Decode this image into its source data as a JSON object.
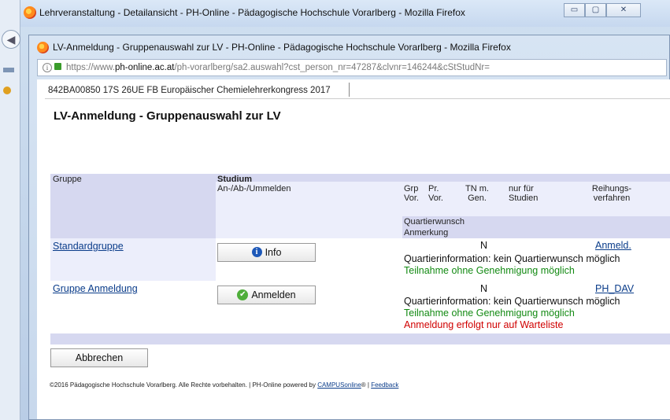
{
  "outer_window": {
    "title": "Lehrveranstaltung - Detailansicht - PH-Online - Pädagogische Hochschule Vorarlberg - Mozilla Firefox",
    "controls": [
      "▭",
      "▢",
      "✕"
    ]
  },
  "inner_window": {
    "title": "LV-Anmeldung - Gruppenauswahl zur LV - PH-Online - Pädagogische Hochschule Vorarlberg - Mozilla Firefox",
    "url_prefix": "https://www.",
    "url_host": "ph-online.ac.at",
    "url_path": "/ph-vorarlberg/sa2.auswahl?cst_person_nr=47287&clvnr=146244&cStStudNr="
  },
  "page": {
    "breadcrumb": "842BA00850 17S 26UE FB Europäischer Chemielehrerkongress 2017",
    "title": "LV-Anmeldung - Gruppenauswahl zur LV"
  },
  "table": {
    "headers": {
      "gruppe": "Gruppe",
      "studium": "Studium",
      "an_ab_um": "An-/Ab-/Ummelden",
      "grp_vor_1": "Grp",
      "grp_vor_2": "Vor.",
      "pr_vor_1": "Pr.",
      "pr_vor_2": "Vor.",
      "tn_gen_1": "TN m.",
      "tn_gen_2": "Gen.",
      "nur_fuer_1": "nur für",
      "nur_fuer_2": "Studien",
      "reihung_1": "Reihungs-",
      "reihung_2": "verfahren",
      "quartierwunsch": "Quartierwunsch",
      "anmerkung": "Anmerkung"
    },
    "rows": [
      {
        "group": "Standardgruppe",
        "button": "Info",
        "tn": "N",
        "reihung": "Anmeld.",
        "quartier": "Quartierinformation: kein Quartierwunsch möglich",
        "note_green": "Teilnahme ohne Genehmigung möglich"
      },
      {
        "group": "Gruppe Anmeldung",
        "button": "Anmelden",
        "tn": "N",
        "reihung": "PH_DAV",
        "quartier": "Quartierinformation: kein Quartierwunsch möglich",
        "note_green": "Teilnahme ohne Genehmigung möglich",
        "note_red": "Anmeldung erfolgt nur auf Warteliste"
      }
    ]
  },
  "actions": {
    "cancel": "Abbrechen"
  },
  "footer": {
    "text": "©2016 Pädagogische Hochschule Vorarlberg. Alle Rechte vorbehalten. | PH-Online powered by ",
    "campus_link": "CAMPUSonline",
    "reg": "® | ",
    "feedback_link": "Feedback"
  }
}
